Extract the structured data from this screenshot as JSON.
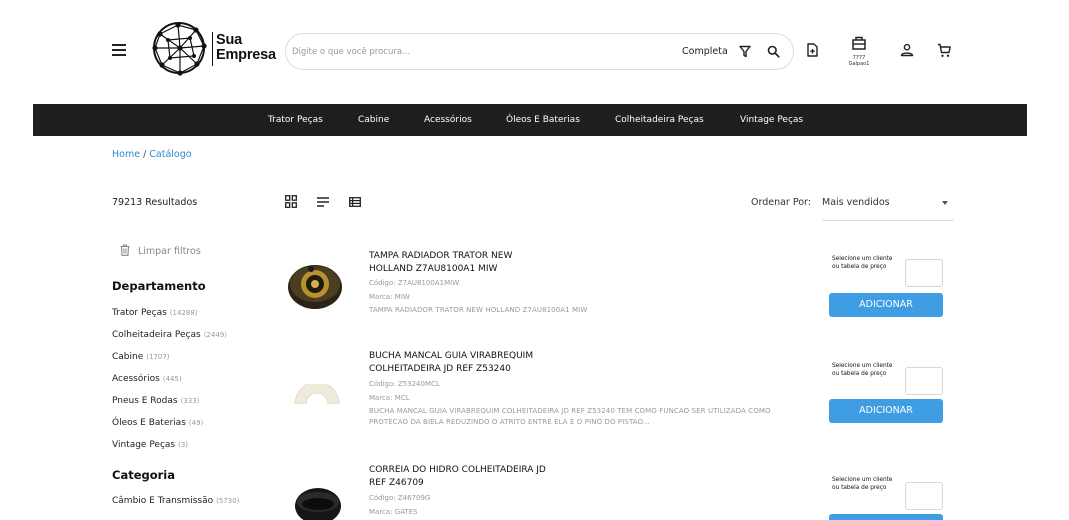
{
  "header": {
    "logo_line1": "Sua",
    "logo_line2": "Empresa",
    "search_placeholder": "Digite o que você procura...",
    "search_mode": "Completa",
    "store_code": "7777",
    "store_name": "Galpao1",
    "icons": [
      "menu-icon",
      "filter-icon",
      "search-icon",
      "document-add-icon",
      "store-icon",
      "user-icon",
      "cart-icon"
    ]
  },
  "nav": [
    "Trator Peças",
    "Cabine",
    "Acessórios",
    "Óleos E Baterias",
    "Colheitadeira Peças",
    "Vintage Peças"
  ],
  "breadcrumb": {
    "home": "Home",
    "separator": "/",
    "current": "Catálogo"
  },
  "toolbar": {
    "results": "79213 Resultados",
    "sort_label": "Ordenar Por:",
    "sort_value": "Mais vendidos"
  },
  "sidebar": {
    "clear_filters": "Limpar filtros",
    "department_title": "Departamento",
    "departments": [
      {
        "label": "Trator Peças",
        "count": "(14288)"
      },
      {
        "label": "Colheitadeira Peças",
        "count": "(2449)"
      },
      {
        "label": "Cabine",
        "count": "(1707)"
      },
      {
        "label": "Acessórios",
        "count": "(445)"
      },
      {
        "label": "Pneus E Rodas",
        "count": "(333)"
      },
      {
        "label": "Óleos E Baterias",
        "count": "(49)"
      },
      {
        "label": "Vintage Peças",
        "count": "(3)"
      }
    ],
    "category_title": "Categoria",
    "categories": [
      {
        "label": "Câmbio E Transmissão",
        "count": "(5730)"
      }
    ]
  },
  "products": [
    {
      "title": "TAMPA RADIADOR TRATOR NEW HOLLAND Z7AU8100A1 MIW",
      "code": "Código: Z7AU8100A1MIW",
      "brand": "Marca: MIW",
      "description": "TAMPA RADIADOR TRATOR NEW HOLLAND Z7AU8100A1 MIW",
      "select_text": "Selecione um cliente ou tabela de preço",
      "add_label": "ADICIONAR"
    },
    {
      "title": "BUCHA MANCAL GUIA VIRABREQUIM COLHEITADEIRA JD REF Z53240",
      "code": "Código: Z53240MCL",
      "brand": "Marca: MCL",
      "description": "BUCHA MANCAL GUIA VIRABREQUIM COLHEITADEIRA JD REF Z53240 TEM COMO FUNCAO SER UTILIZADA COMO PROTECAO DA BIELA REDUZINDO O ATRITO ENTRE ELA E O PINO DO PISTAO...",
      "select_text": "Selecione um cliente ou tabela de preço",
      "add_label": "ADICIONAR"
    },
    {
      "title": "CORREIA DO HIDRO COLHEITADEIRA JD REF Z46709",
      "code": "Código: Z46709G",
      "brand": "Marca: GATES",
      "select_text": "Selecione um cliente ou tabela de preço"
    }
  ],
  "colors": {
    "nav_bg": "#1f1f1f",
    "accent": "#3e9de3",
    "link": "#2b8bd0"
  }
}
